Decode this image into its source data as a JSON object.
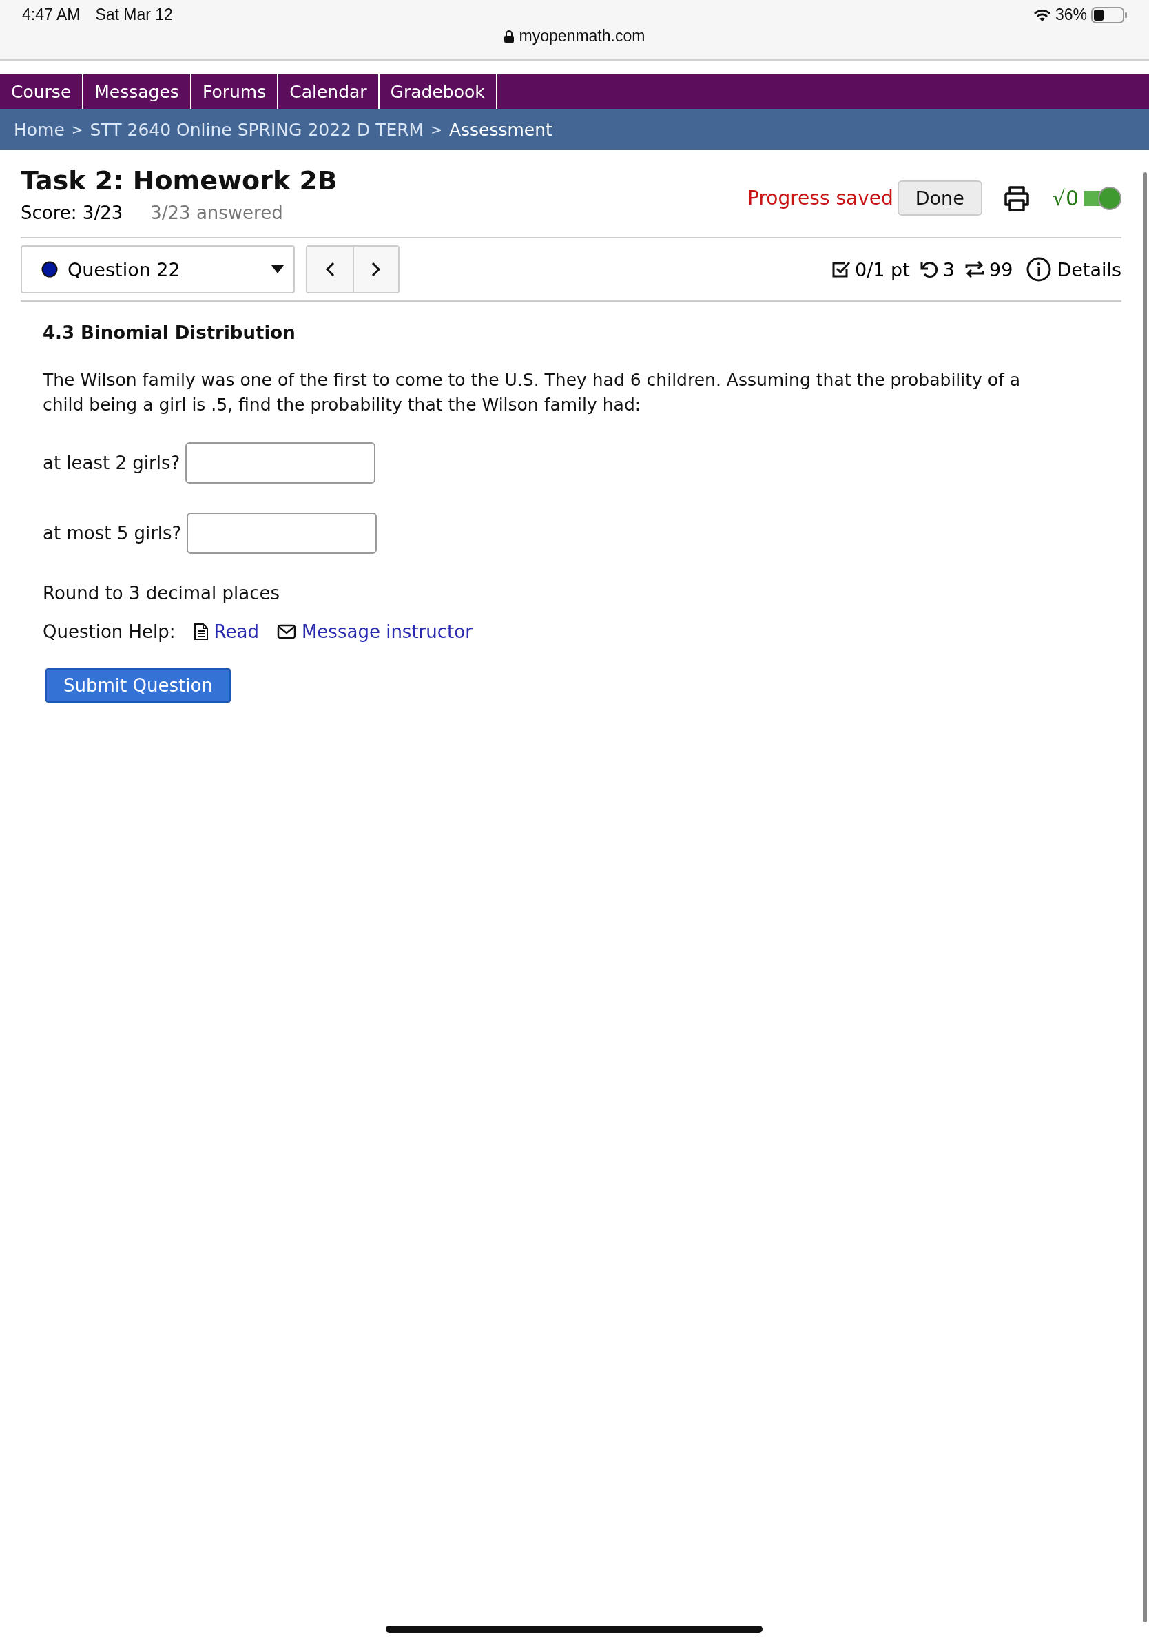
{
  "status_bar": {
    "time": "4:47 AM",
    "date": "Sat Mar 12",
    "battery": "36%"
  },
  "address_bar": {
    "url": "myopenmath.com"
  },
  "nav_tabs": [
    {
      "label": "Course"
    },
    {
      "label": "Messages"
    },
    {
      "label": "Forums"
    },
    {
      "label": "Calendar"
    },
    {
      "label": "Gradebook"
    }
  ],
  "breadcrumb": [
    {
      "label": "Home",
      "kind": "link"
    },
    {
      "label": ">",
      "kind": "sep"
    },
    {
      "label": "STT 2640 Online SPRING 2022 D TERM",
      "kind": "link"
    },
    {
      "label": ">",
      "kind": "sep"
    },
    {
      "label": "Assessment",
      "kind": "current"
    }
  ],
  "header": {
    "title": "Task 2: Homework 2B",
    "score": "Score: 3/23",
    "answered": "3/23 answered",
    "progress": "Progress saved",
    "done_button": "Done",
    "math_toggle": {
      "label": "√0",
      "on": true
    }
  },
  "question_bar": {
    "selector": "Question 22",
    "points": "0/1 pt",
    "retries": "3",
    "regens": "99",
    "details": "Details"
  },
  "question": {
    "heading": "4.3 Binomial Distribution",
    "text": "The Wilson family was one of the first to come to the U.S. They had 6 children. Assuming that the probability of a child being a girl is .5, find the probability that the Wilson family had:",
    "answers": [
      {
        "label": "at least 2 girls?"
      },
      {
        "label": "at most 5 girls?"
      }
    ],
    "note": "Round to 3 decimal places",
    "help_label": "Question Help:",
    "help_links": [
      {
        "label": "Read",
        "kind": "read"
      },
      {
        "label": "Message instructor",
        "kind": "message"
      }
    ],
    "submit": "Submit Question"
  }
}
